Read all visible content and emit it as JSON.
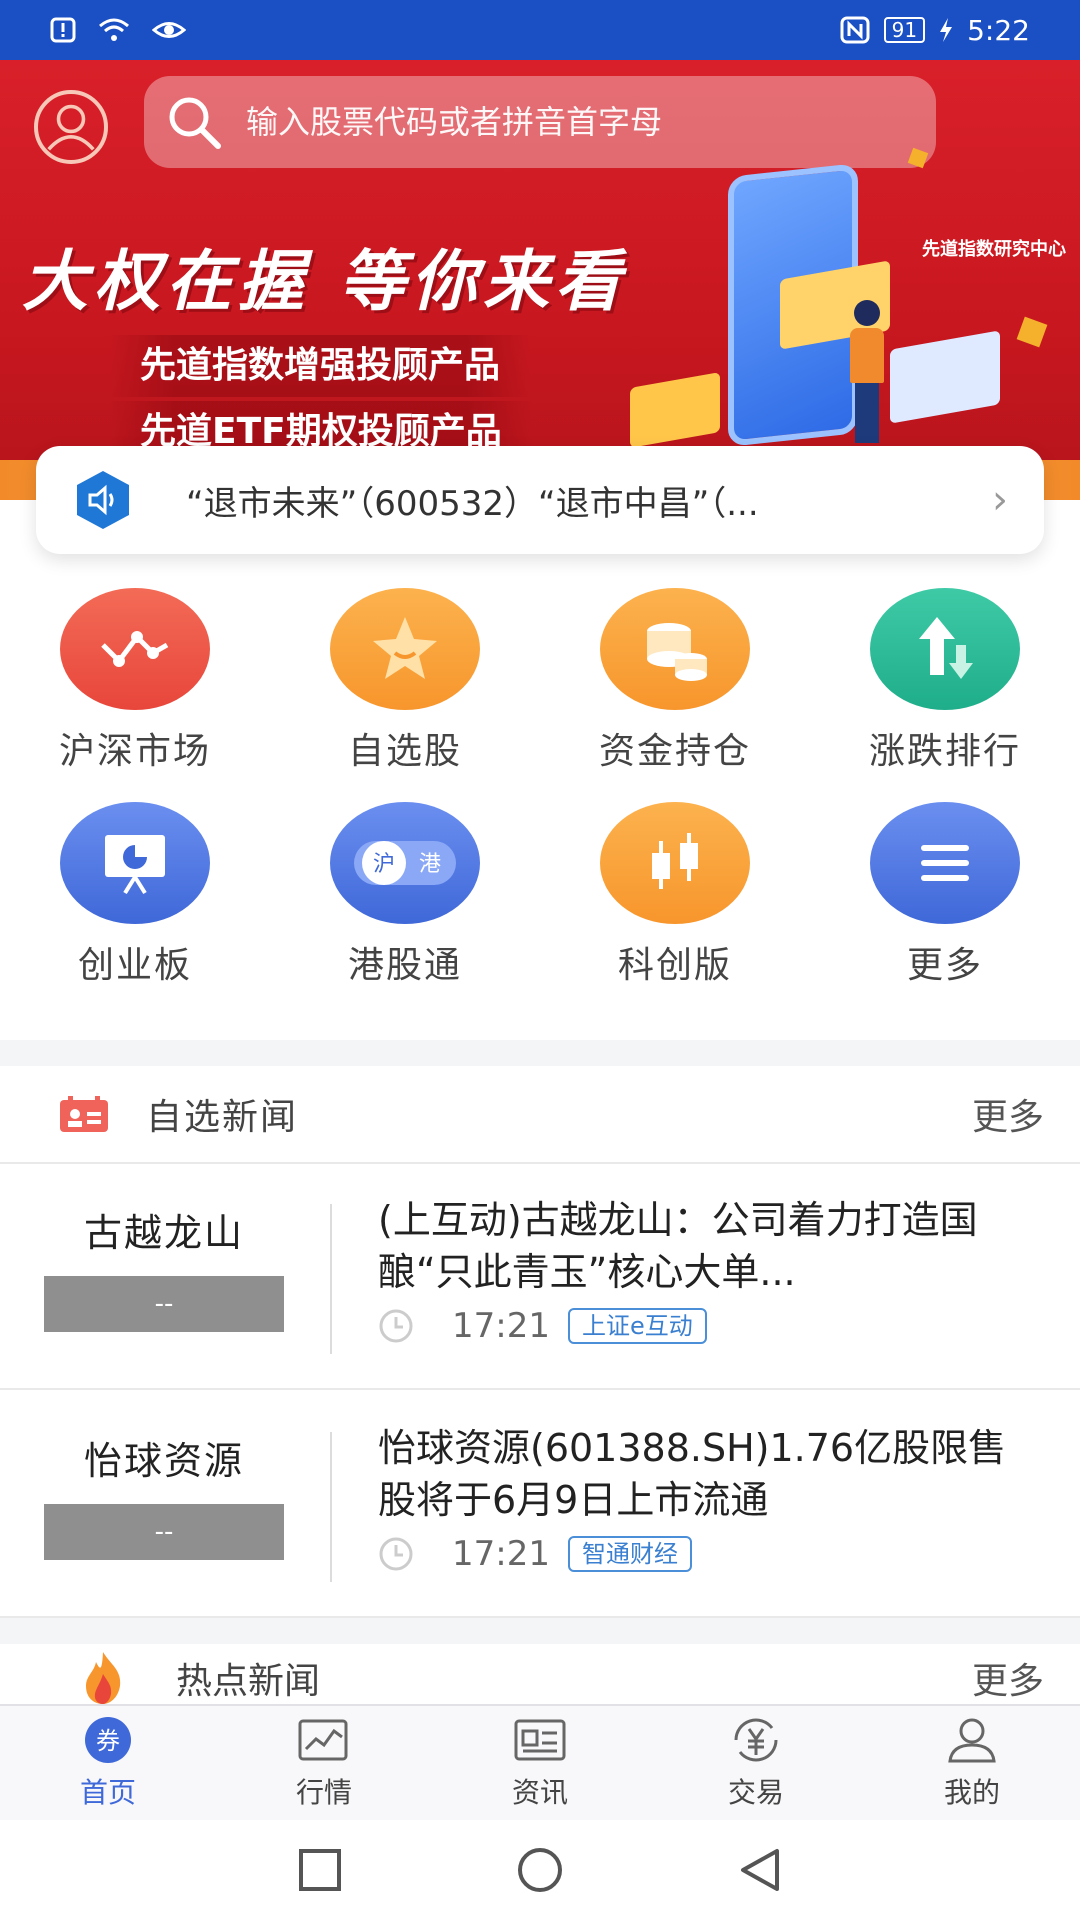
{
  "status_bar": {
    "time": "5:22",
    "battery": "91"
  },
  "search": {
    "placeholder": "输入股票代码或者拼音首字母"
  },
  "banner": {
    "headline": "大权在握  等你来看",
    "line1": "先道指数增强投顾产品",
    "line2": "先道ETF期权投顾产品",
    "org": "先道指数研究中心"
  },
  "notice": {
    "text": "“退市未来”（600532）“退市中昌”（..."
  },
  "grid": [
    {
      "label": "沪深市场",
      "icon": "market-trend-icon",
      "color": "#e8463b"
    },
    {
      "label": "自选股",
      "icon": "star-icon",
      "color": "#f7962c"
    },
    {
      "label": "资金持仓",
      "icon": "coins-icon",
      "color": "#f7962c"
    },
    {
      "label": "涨跌排行",
      "icon": "up-down-arrows-icon",
      "color": "#1fae8a"
    },
    {
      "label": "创业板",
      "icon": "presentation-icon",
      "color": "#3f68d8"
    },
    {
      "label": "港股通",
      "icon": "hk-connect-icon",
      "color": "#3f68d8",
      "badge_left": "沪",
      "badge_right": "港"
    },
    {
      "label": "科创版",
      "icon": "candlestick-icon",
      "color": "#f7962c"
    },
    {
      "label": "更多",
      "icon": "menu-icon",
      "color": "#3f68d8"
    }
  ],
  "watch_news": {
    "title": "自选新闻",
    "more": "更多",
    "items": [
      {
        "stock": "古越龙山",
        "badge": "--",
        "headline": "(上互动)古越龙山：公司着力打造国酿“只此青玉”核心大单...",
        "time": "17:21",
        "source": "上证e互动"
      },
      {
        "stock": "怡球资源",
        "badge": "--",
        "headline": "怡球资源(601388.SH)1.76亿股限售股将于6月9日上市流通",
        "time": "17:21",
        "source": "智通财经"
      }
    ]
  },
  "hot_news": {
    "title": "热点新闻",
    "more": "更多"
  },
  "bottom_nav": [
    {
      "label": "首页",
      "active": true,
      "glyph": "券"
    },
    {
      "label": "行情"
    },
    {
      "label": "资讯"
    },
    {
      "label": "交易"
    },
    {
      "label": "我的"
    }
  ],
  "colors": {
    "primary": "#3f68d8",
    "status_bar": "#1b4fc4",
    "banner_red": "#d9202a"
  }
}
